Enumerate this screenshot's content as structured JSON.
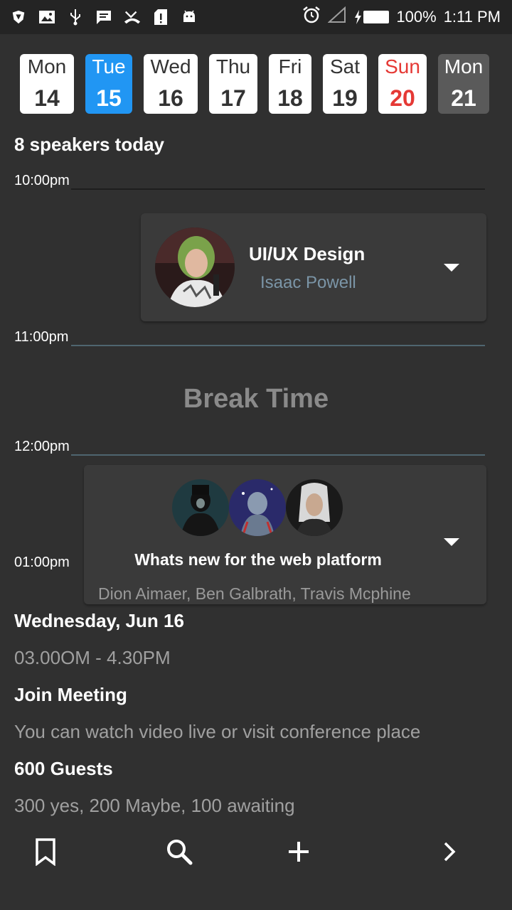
{
  "status_bar": {
    "battery": "100%",
    "time": "1:11 PM"
  },
  "dates": [
    {
      "day": "Mon",
      "num": "14",
      "state": "normal"
    },
    {
      "day": "Tue",
      "num": "15",
      "state": "selected"
    },
    {
      "day": "Wed",
      "num": "16",
      "state": "normal"
    },
    {
      "day": "Thu",
      "num": "17",
      "state": "normal"
    },
    {
      "day": "Fri",
      "num": "18",
      "state": "normal"
    },
    {
      "day": "Sat",
      "num": "19",
      "state": "normal"
    },
    {
      "day": "Sun",
      "num": "20",
      "state": "sunday"
    },
    {
      "day": "Mon",
      "num": "21",
      "state": "dark"
    }
  ],
  "speakers_today": "8 speakers today",
  "schedule": {
    "time_1": "10:00pm",
    "time_2": "11:00pm",
    "time_3": "12:00pm",
    "time_4": "01:00pm",
    "session_1": {
      "title": "UI/UX Design",
      "speaker": "Isaac Powell"
    },
    "break_text": "Break Time",
    "session_2": {
      "title": "Whats new for the web platform",
      "speakers": "Dion Aimaer, Ben Galbrath, Travis Mcphine"
    }
  },
  "details": {
    "date": "Wednesday, Jun 16",
    "time_range": "03.00OM - 4.30PM",
    "join_title": "Join Meeting",
    "join_text": "You can watch video live or visit conference place",
    "guests_title": "600 Guests",
    "guests_text": "300 yes, 200 Maybe, 100 awaiting"
  },
  "colors": {
    "background": "#303030",
    "accent": "#2196f3",
    "sunday": "#e53935",
    "speaker_name": "#7b95a7"
  },
  "icons": [
    "bookmark-icon",
    "search-icon",
    "add-icon",
    "chevron-right-icon"
  ]
}
